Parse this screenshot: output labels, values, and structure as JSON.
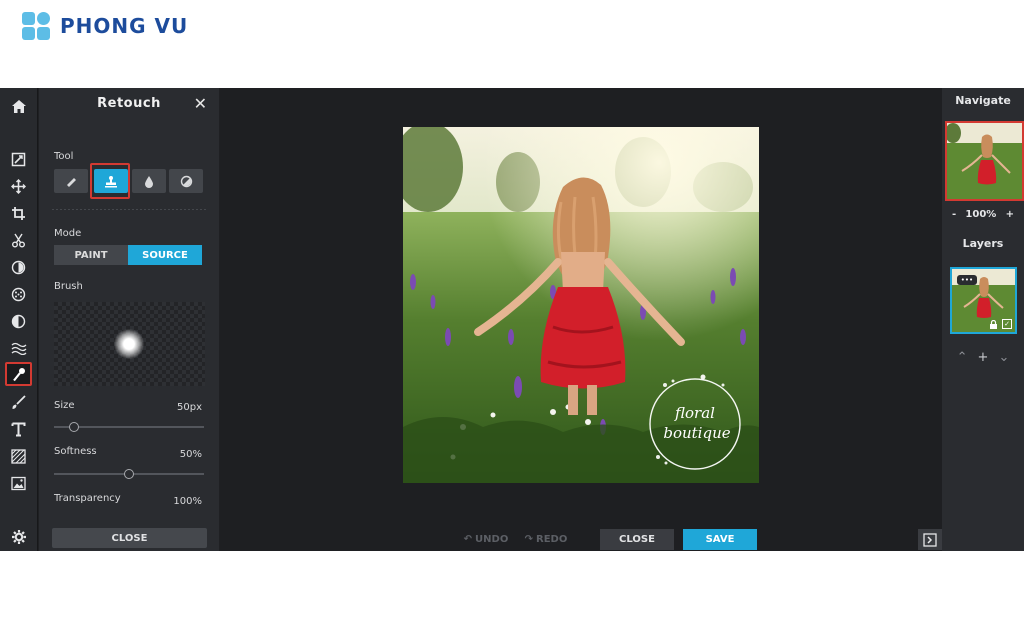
{
  "brand": {
    "name": "PHONG VU"
  },
  "panel": {
    "title": "Retouch",
    "tool_label": "Tool",
    "mode_label": "Mode",
    "mode_options": [
      "PAINT",
      "SOURCE"
    ],
    "mode_selected": "SOURCE",
    "brush_label": "Brush",
    "size_label": "Size",
    "size_value": "50px",
    "softness_label": "Softness",
    "softness_value": "50%",
    "transparency_label": "Transparency",
    "transparency_value": "100%",
    "close_label": "CLOSE"
  },
  "tools": [
    "eraser-icon",
    "clone-stamp-icon",
    "blur-drop-icon",
    "contrast-icon"
  ],
  "selected_tool": "clone-stamp-icon",
  "sidebar_tools": [
    "pencil-edit-icon",
    "move-icon",
    "crop-icon",
    "cut-icon",
    "adjust-icon",
    "filter-icon",
    "effect-icon",
    "wave-icon",
    "retouch-icon",
    "brush-icon",
    "text-icon",
    "texture-icon",
    "image-icon"
  ],
  "active_sidebar_tool": "retouch-icon",
  "canvas": {
    "undo_label": "UNDO",
    "redo_label": "REDO",
    "close_label": "CLOSE",
    "save_label": "SAVE",
    "watermark_line1": "floral",
    "watermark_line2": "boutique"
  },
  "navigate": {
    "title": "Navigate",
    "zoom": "100%",
    "minus": "-",
    "plus": "+"
  },
  "layers": {
    "title": "Layers",
    "badge": "•••"
  },
  "colors": {
    "accent": "#1fa7d8",
    "highlight": "#d33a32",
    "brand_blue": "#1d4c9c",
    "brand_light": "#5dbde6"
  }
}
